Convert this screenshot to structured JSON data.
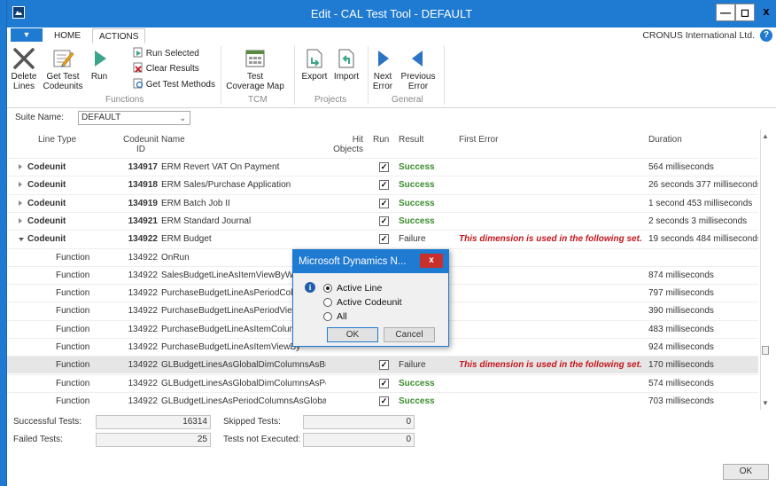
{
  "window": {
    "title": "Edit - CAL Test Tool - DEFAULT"
  },
  "tabs": {
    "home": "HOME",
    "actions": "ACTIONS"
  },
  "company": "CRONUS International Ltd.",
  "ribbon": {
    "delete_lines": "Delete\nLines",
    "get_test_codeunits": "Get Test\nCodeunits",
    "run": "Run",
    "run_selected": "Run Selected",
    "clear_results": "Clear Results",
    "get_test_methods": "Get Test Methods",
    "group_functions": "Functions",
    "test_coverage_map": "Test\nCoverage Map",
    "group_tcm": "TCM",
    "export": "Export",
    "import": "Import",
    "group_projects": "Projects",
    "next_error": "Next\nError",
    "previous_error": "Previous\nError",
    "group_general": "General"
  },
  "suite": {
    "label": "Suite Name:",
    "value": "DEFAULT"
  },
  "columns": {
    "line_type": "Line Type",
    "codeunit_id": "Codeunit\nID",
    "name": "Name",
    "hit_objects": "Hit\nObjects",
    "run": "Run",
    "result": "Result",
    "first_error": "First Error",
    "duration": "Duration"
  },
  "rows": [
    {
      "type": "Codeunit",
      "id": "134917",
      "name": "ERM Revert VAT On Payment",
      "run": "✓",
      "result": "Success",
      "error": "",
      "duration": "564 milliseconds"
    },
    {
      "type": "Codeunit",
      "id": "134918",
      "name": "ERM Sales/Purchase Application",
      "run": "✓",
      "result": "Success",
      "error": "",
      "duration": "26 seconds 377 milliseconds"
    },
    {
      "type": "Codeunit",
      "id": "134919",
      "name": "ERM Batch Job II",
      "run": "✓",
      "result": "Success",
      "error": "",
      "duration": "1 second 453 milliseconds"
    },
    {
      "type": "Codeunit",
      "id": "134921",
      "name": "ERM Standard Journal",
      "run": "✓",
      "result": "Success",
      "error": "",
      "duration": "2 seconds 3 milliseconds"
    },
    {
      "type": "Codeunit",
      "id": "134922",
      "name": "ERM Budget",
      "run": "✓",
      "result": "Failure",
      "error": "This dimension is used in the following set...",
      "duration": "19 seconds 484 milliseconds"
    },
    {
      "type": "Function",
      "id": "134922",
      "name": "OnRun",
      "run": "",
      "result": "",
      "error": "",
      "duration": ""
    },
    {
      "type": "Function",
      "id": "134922",
      "name": "SalesBudgetLineAsItemViewByWee",
      "run": "",
      "result": "",
      "error": "",
      "duration": "874 milliseconds"
    },
    {
      "type": "Function",
      "id": "134922",
      "name": "PurchaseBudgetLineAsPeriodColum",
      "run": "",
      "result": "",
      "error": "",
      "duration": "797 milliseconds"
    },
    {
      "type": "Function",
      "id": "134922",
      "name": "PurchaseBudgetLineAsPeriodViewB",
      "run": "",
      "result": "",
      "error": "",
      "duration": "390 milliseconds"
    },
    {
      "type": "Function",
      "id": "134922",
      "name": "PurchaseBudgetLineAsItemColumn",
      "run": "",
      "result": "",
      "error": "",
      "duration": "483 milliseconds"
    },
    {
      "type": "Function",
      "id": "134922",
      "name": "PurchaseBudgetLineAsItemViewBy",
      "run": "",
      "result": "",
      "error": "",
      "duration": "924 milliseconds"
    },
    {
      "type": "Function",
      "id": "134922",
      "name": "GLBudgetLinesAsGlobalDimColumnsAsBu...",
      "run": "✓",
      "result": "Failure",
      "error": "This dimension is used in the following set...",
      "duration": "170 milliseconds"
    },
    {
      "type": "Function",
      "id": "134922",
      "name": "GLBudgetLinesAsGlobalDimColumnsAsPe...",
      "run": "✓",
      "result": "Success",
      "error": "",
      "duration": "574 milliseconds"
    },
    {
      "type": "Function",
      "id": "134922",
      "name": "GLBudgetLinesAsPeriodColumnsAsGlobal...",
      "run": "✓",
      "result": "Success",
      "error": "",
      "duration": "703 milliseconds"
    }
  ],
  "stats": {
    "successful_label": "Successful Tests:",
    "successful_value": "16314",
    "failed_label": "Failed Tests:",
    "failed_value": "25",
    "skipped_label": "Skipped Tests:",
    "skipped_value": "0",
    "not_executed_label": "Tests not Executed:",
    "not_executed_value": "0"
  },
  "ok_label": "OK",
  "dialog": {
    "title": "Microsoft Dynamics N...",
    "close": "x",
    "options": [
      "Active Line",
      "Active Codeunit",
      "All"
    ],
    "selected": "Active Line",
    "ok": "OK",
    "cancel": "Cancel"
  },
  "colors": {
    "accent": "#1f7ad1",
    "success": "#3b8c2c",
    "error": "#c4161c"
  }
}
